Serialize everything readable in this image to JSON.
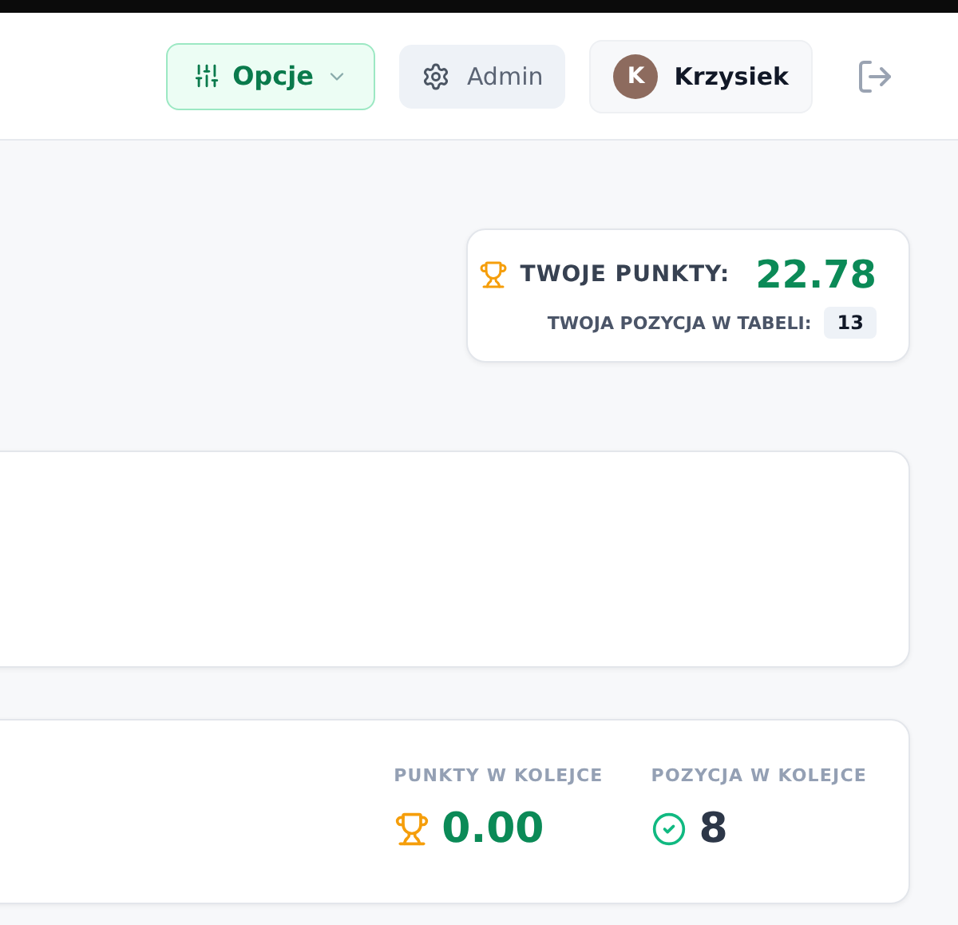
{
  "header": {
    "options_button": {
      "label": "Opcje"
    },
    "admin_button": {
      "label": "Admin"
    },
    "user": {
      "initial": "K",
      "name": "Krzysiek"
    }
  },
  "score_card": {
    "points_label": "TWOJE PUNKTY:",
    "points_value": "22.78",
    "position_label": "TWOJA POZYCJA W TABELI:",
    "position_value": "13"
  },
  "round_card": {
    "stats": [
      {
        "kind": "points",
        "label": "PUNKTY W KOLEJCE",
        "value": "0.00"
      },
      {
        "kind": "position",
        "label": "POZYCJA W KOLEJCE",
        "value": "8"
      }
    ]
  }
}
